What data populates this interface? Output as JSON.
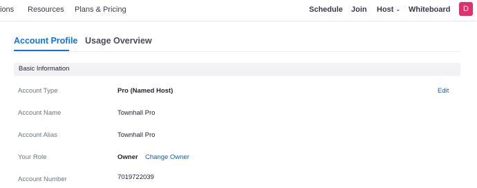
{
  "topnav": {
    "left_links": [
      "ions",
      "Resources",
      "Plans & Pricing"
    ],
    "right_links": {
      "schedule": "Schedule",
      "join": "Join",
      "host": "Host",
      "whiteboard": "Whiteboard"
    },
    "avatar_initial": "D",
    "avatar_color": "#e0316a"
  },
  "tabs": {
    "account_profile": "Account Profile",
    "usage_overview": "Usage Overview"
  },
  "section": {
    "title": "Basic Information"
  },
  "rows": {
    "account_type": {
      "label": "Account Type",
      "value": "Pro (Named Host)",
      "action": "Edit"
    },
    "account_name": {
      "label": "Account Name",
      "value": "Townhall Pro"
    },
    "account_alias": {
      "label": "Account Alias",
      "value": "Townhall Pro"
    },
    "your_role": {
      "label": "Your Role",
      "value": "Owner",
      "action": "Change Owner"
    },
    "account_number": {
      "label": "Account Number",
      "value": "7019722039"
    }
  },
  "colors": {
    "accent": "#0e72ed",
    "link": "#0e5eb5"
  }
}
